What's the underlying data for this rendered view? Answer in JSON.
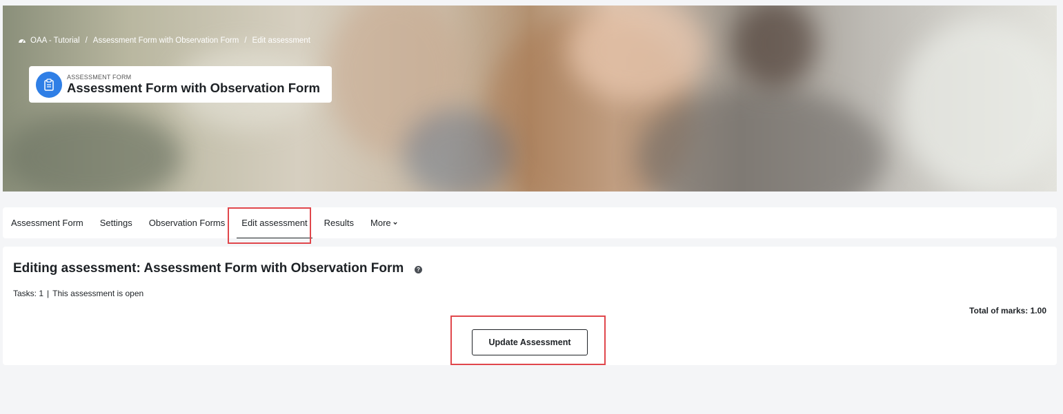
{
  "breadcrumb": {
    "items": [
      "OAA - Tutorial",
      "Assessment Form with Observation Form",
      "Edit assessment"
    ],
    "separator": "/"
  },
  "header": {
    "kicker": "ASSESSMENT FORM",
    "title": "Assessment Form with Observation Form"
  },
  "nav": {
    "tabs": [
      "Assessment Form",
      "Settings",
      "Observation Forms",
      "Edit assessment",
      "Results",
      "More"
    ],
    "active": "Edit assessment"
  },
  "main": {
    "heading": "Editing assessment: Assessment Form with Observation Form",
    "help": "?",
    "tasks": "Tasks: 1",
    "status": "This assessment is open",
    "pipe": "|",
    "total": "Total of marks: 1.00",
    "update_button": "Update Assessment"
  },
  "colors": {
    "accent": "#2f7fe6",
    "highlight": "#e0464b",
    "page_bg": "#f4f5f7"
  }
}
